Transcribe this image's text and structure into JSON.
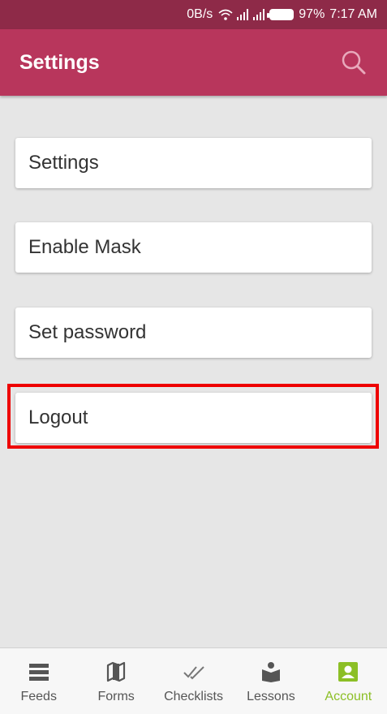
{
  "status_bar": {
    "net_speed": "0B/s",
    "battery_pct": "97%",
    "time": "7:17 AM"
  },
  "app_bar": {
    "title": "Settings",
    "search_icon": "search-icon"
  },
  "menu": {
    "items": [
      {
        "label": "Settings"
      },
      {
        "label": "Enable Mask"
      },
      {
        "label": "Set password"
      },
      {
        "label": "Logout"
      }
    ]
  },
  "bottom_nav": {
    "items": [
      {
        "label": "Feeds",
        "icon": "feeds-icon"
      },
      {
        "label": "Forms",
        "icon": "map-icon"
      },
      {
        "label": "Checklists",
        "icon": "double-check-icon"
      },
      {
        "label": "Lessons",
        "icon": "reader-icon"
      },
      {
        "label": "Account",
        "icon": "account-icon"
      }
    ],
    "active": "Account"
  },
  "colors": {
    "status_bar": "#8e2a48",
    "app_bar": "#b8365c",
    "active_tab": "#8cbf26",
    "highlight": "#ee0000"
  }
}
